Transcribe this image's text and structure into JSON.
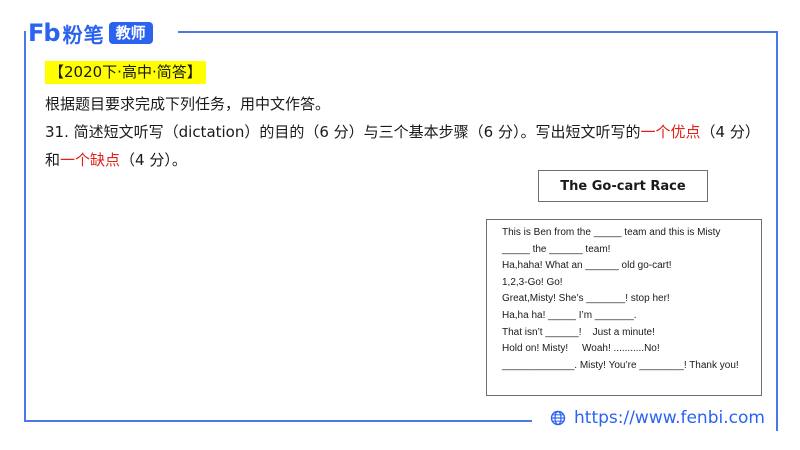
{
  "brand": {
    "logo_mark": "Fb",
    "name": "粉笔",
    "tag": "教师"
  },
  "footer": {
    "url": "https://www.fenbi.com",
    "icon": "globe-icon"
  },
  "colors": {
    "accent": "#2b63f0",
    "frame": "#4f76e6",
    "highlight": "#ffff00",
    "emphasis": "#e0201b"
  },
  "question": {
    "tag": "【2020下·高中·简答】",
    "instruction": "根据题目要求完成下列任务，用中文作答。",
    "line1_part1": "31. 简述短文听写（dictation）的目的（6 分）与三个基本步骤（6 分）。写出短文听写的",
    "line1_red": "一个优点",
    "line1_part2": "（4 分）",
    "line2_part1": "和",
    "line2_red": "一个缺点",
    "line2_part2": "（4 分）。"
  },
  "worksheet": {
    "title": "The Go-cart Race",
    "lines": [
      "This is Ben from the _____ team and this is Misty",
      "_____ the ______ team!",
      "Ha,haha! What an ______ old go-cart!",
      "1,2,3-Go! Go!",
      "Great,Misty! She’s _______! stop her!",
      "Ha,ha ha! _____ I’m _______.",
      "That isn’t ______!    Just a minute!",
      "Hold on! Misty!     Woah! ...........No!",
      "_____________. Misty! You’re ________! Thank you!"
    ]
  }
}
